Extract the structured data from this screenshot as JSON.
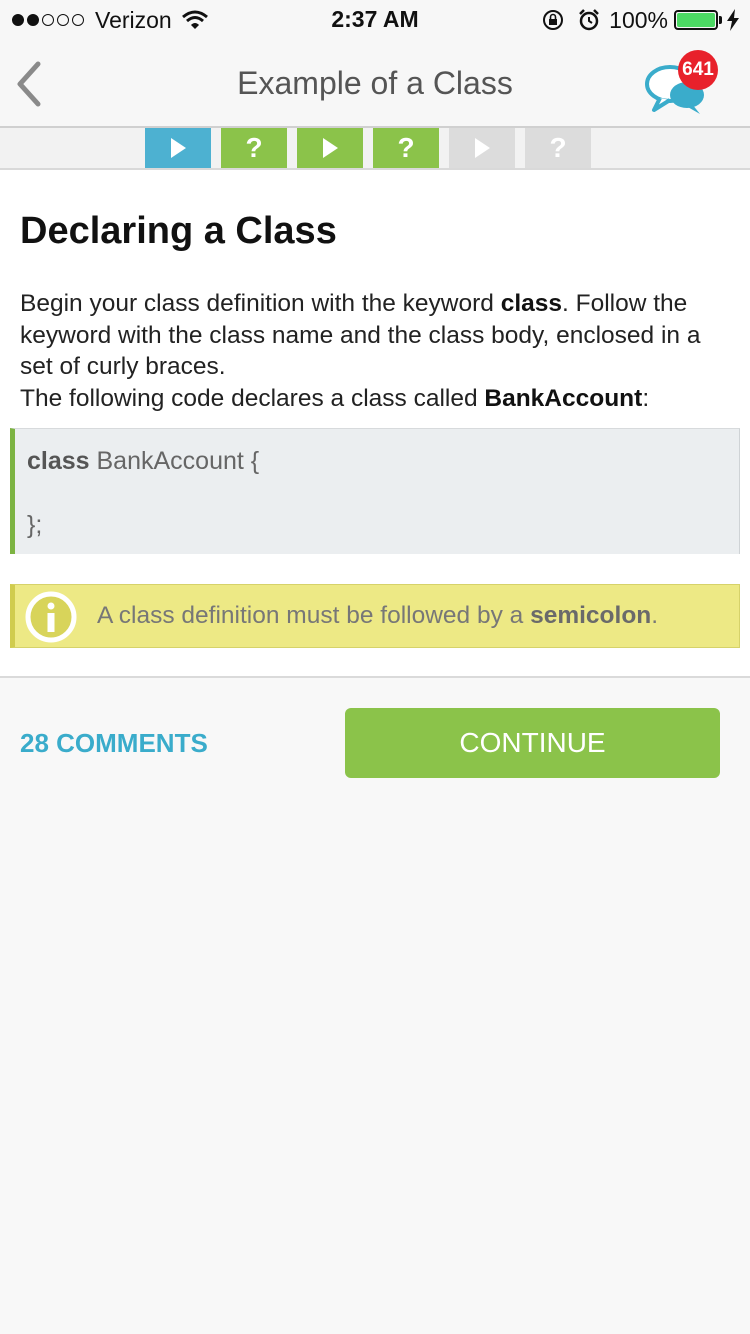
{
  "status_bar": {
    "carrier": "Verizon",
    "time": "2:37 AM",
    "battery": "100%",
    "signal_bars_filled": 2,
    "signal_bars_total": 5
  },
  "nav": {
    "title": "Example of a Class",
    "back_icon": "chevron-left-icon",
    "chat_icon": "chat-bubbles-icon",
    "badge_count": "641"
  },
  "steps": [
    {
      "type": "lesson",
      "symbol": "",
      "state": "current",
      "color": "#4db1d1"
    },
    {
      "type": "quiz",
      "symbol": "?",
      "state": "done",
      "color": "#8bc34a"
    },
    {
      "type": "lesson",
      "symbol": "",
      "state": "done",
      "color": "#8bc34a"
    },
    {
      "type": "quiz",
      "symbol": "?",
      "state": "done",
      "color": "#8bc34a"
    },
    {
      "type": "lesson",
      "symbol": "",
      "state": "locked",
      "color": "#dcdcdc"
    },
    {
      "type": "quiz",
      "symbol": "?",
      "state": "locked",
      "color": "#dcdcdc"
    }
  ],
  "lesson": {
    "heading": "Declaring a Class",
    "para1_before": "Begin your class definition with the keyword ",
    "para1_bold": "class",
    "para1_after": ". Follow the keyword with the class name and the class body, enclosed in a set of curly braces.",
    "para2_before": "The following code declares a class called ",
    "para2_bold": "BankAccount",
    "para2_after": ":",
    "code_keyword": "class",
    "code_rest": " BankAccount {",
    "code_close": "};",
    "note_before": "A class definition must be followed by a ",
    "note_bold": "semicolon",
    "note_after": "."
  },
  "actions": {
    "comments": "28 COMMENTS",
    "continue": "CONTINUE"
  },
  "colors": {
    "accent_blue": "#3aaccb",
    "accent_green": "#8bc34a",
    "badge_red": "#e8212b",
    "note_yellow": "#ede985"
  }
}
